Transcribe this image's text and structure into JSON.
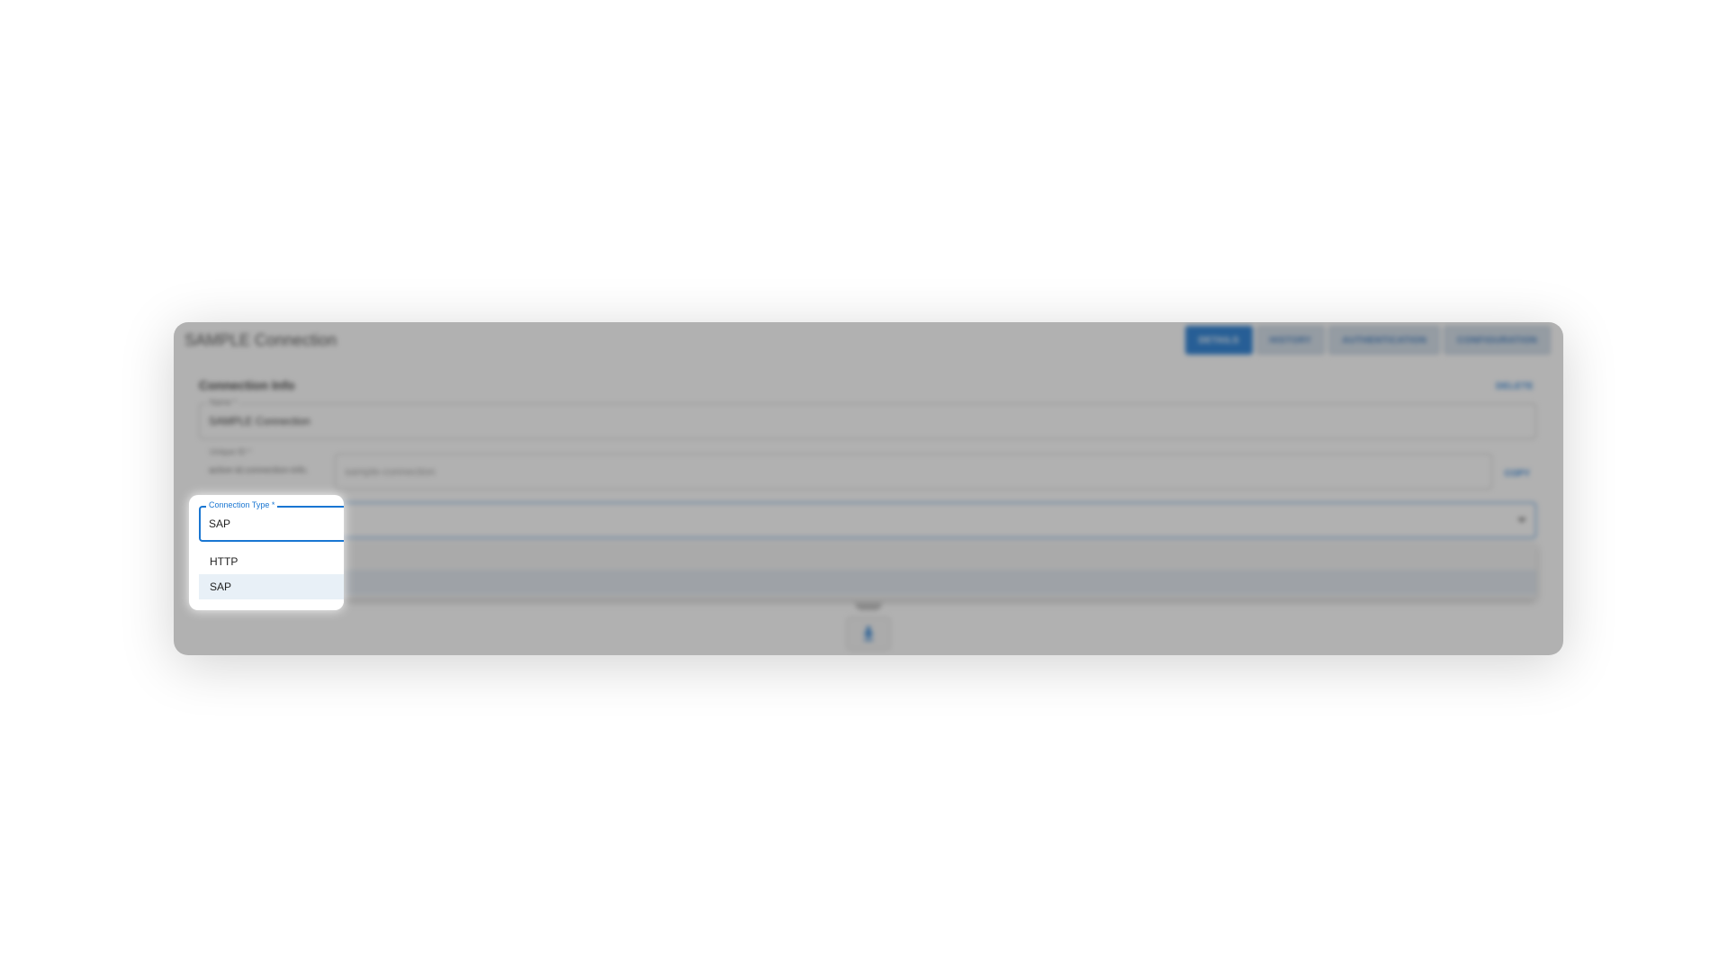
{
  "header": {
    "title": "SAMPLE Connection",
    "tabs": [
      {
        "label": "DETAILS",
        "active": true
      },
      {
        "label": "HISTORY",
        "active": false
      },
      {
        "label": "AUTHENTICATION",
        "active": false
      },
      {
        "label": "CONFIGURATION",
        "active": false
      }
    ]
  },
  "section": {
    "title": "Connection Info",
    "delete_label": "DELETE"
  },
  "fields": {
    "name": {
      "label": "Name *",
      "value": "SAMPLE Connection"
    },
    "unique_id": {
      "label": "Unique ID *",
      "prefix": "active-id.connection-info.",
      "value": "sample-connection",
      "copy_label": "COPY"
    },
    "connection_type": {
      "label": "Connection Type *",
      "value": "SAP"
    }
  },
  "dropdown": {
    "options": [
      {
        "label": "HTTP",
        "selected": false
      },
      {
        "label": "SAP",
        "selected": true
      }
    ]
  },
  "colors": {
    "accent": "#1976d2",
    "selected_row": "#e8f0f7"
  },
  "icons": {
    "bottom_action": "download-icon",
    "select_caret": "caret-down-icon"
  }
}
